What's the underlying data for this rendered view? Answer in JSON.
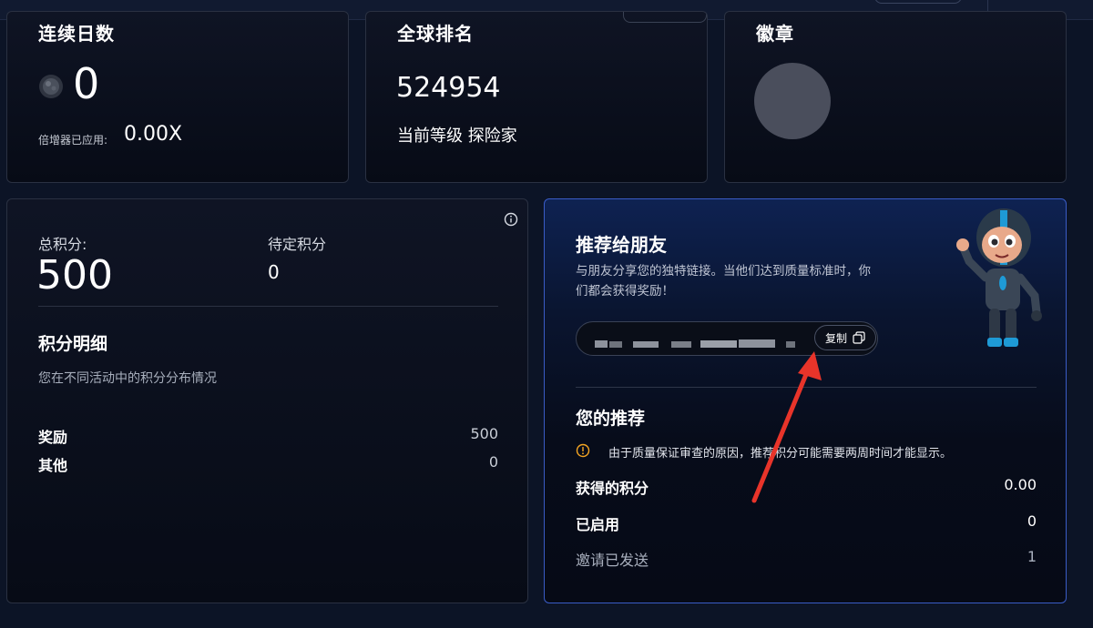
{
  "streak": {
    "title": "连续日数",
    "value": "0",
    "multiplier_label": "倍增器已应用:",
    "multiplier_value": "0.00X"
  },
  "rank": {
    "title": "全球排名",
    "value": "524954",
    "level_text": "当前等级 探险家"
  },
  "badge": {
    "title": "徽章"
  },
  "points": {
    "total_label": "总积分:",
    "total_value": "500",
    "pending_label": "待定积分",
    "pending_value": "0",
    "breakdown_title": "积分明细",
    "breakdown_subtitle": "您在不同活动中的积分分布情况",
    "rows": [
      {
        "label": "奖励",
        "value": "500"
      },
      {
        "label": "其他",
        "value": "0"
      }
    ]
  },
  "referral": {
    "title": "推荐给朋友",
    "description_line1": "与朋友分享您的独特链接。当他们达到质量标准时，你",
    "description_line2": "们都会获得奖励！",
    "copy_label": "复制",
    "my_referrals_title": "您的推荐",
    "notice": "由于质量保证审查的原因，推荐积分可能需要两周时间才能显示。",
    "stats": [
      {
        "label": "获得的积分",
        "value": "0.00"
      },
      {
        "label": "已启用",
        "value": "0"
      },
      {
        "label": "邀请已发送",
        "value": "1"
      }
    ]
  },
  "colors": {
    "background": "#0c1426",
    "card_border": "#2a3142",
    "referral_border": "#3a5cc6",
    "annotation_arrow": "#e8342a",
    "notice_icon": "#f5a623"
  },
  "icons": [
    "streak-coin-icon",
    "info-icon",
    "copy-icon",
    "warning-icon",
    "robot-mascot",
    "annotation-arrow"
  ]
}
